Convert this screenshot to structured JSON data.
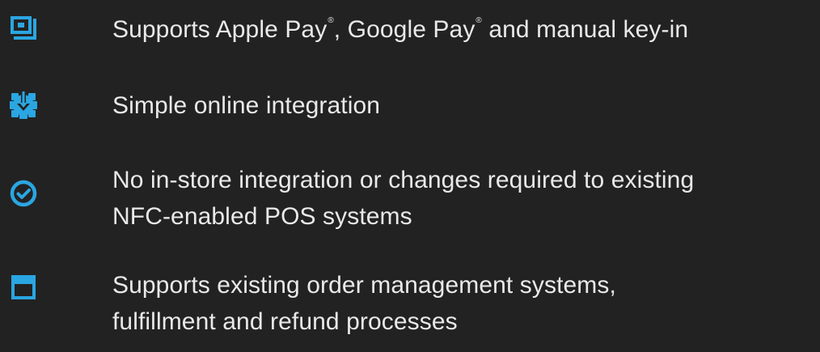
{
  "theme": {
    "background": "#222222",
    "text_color": "#e9e9e9",
    "icon_color": "#2aa6e2"
  },
  "features": [
    {
      "icon": "nfc-reader-icon",
      "text_parts": [
        "Supports Apple Pay",
        "®",
        ", Google Pay",
        "®",
        " and manual key-in"
      ]
    },
    {
      "icon": "gear-download-icon",
      "text": "Simple online integration"
    },
    {
      "icon": "check-circle-icon",
      "text_line1": "No in-store integration or changes required to existing",
      "text_line2": "NFC-enabled POS systems"
    },
    {
      "icon": "storefront-icon",
      "text_line1": "Supports existing order management systems,",
      "text_line2": "fulfillment and refund processes"
    }
  ]
}
